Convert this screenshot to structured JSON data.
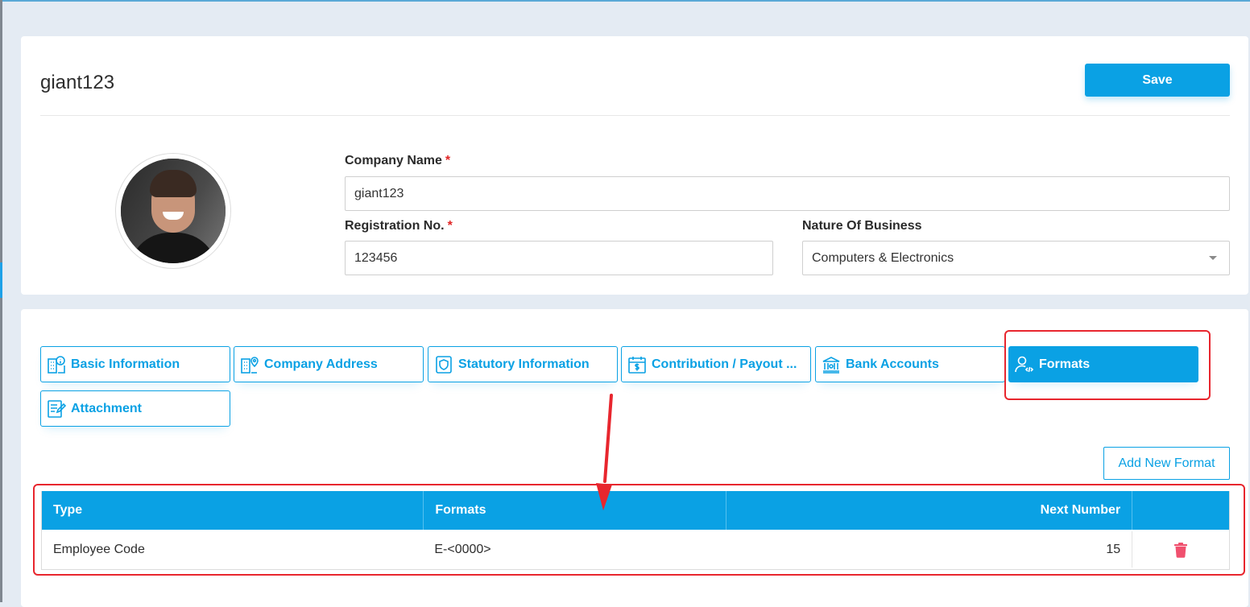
{
  "header": {
    "title": "giant123",
    "save_label": "Save"
  },
  "form": {
    "company_name": {
      "label": "Company Name",
      "required": "*",
      "value": "giant123"
    },
    "registration_no": {
      "label": "Registration No.",
      "required": "*",
      "value": "123456"
    },
    "nature_of_business": {
      "label": "Nature Of Business",
      "value": "Computers & Electronics"
    }
  },
  "tabs": [
    {
      "label": "Basic Information",
      "icon": "building-info-icon",
      "active": false
    },
    {
      "label": "Company Address",
      "icon": "building-pin-icon",
      "active": false
    },
    {
      "label": "Statutory Information",
      "icon": "shield-document-icon",
      "active": false
    },
    {
      "label": "Contribution / Payout ...",
      "icon": "calendar-dollar-icon",
      "active": false
    },
    {
      "label": "Bank Accounts",
      "icon": "bank-icon",
      "active": false
    },
    {
      "label": "Formats",
      "icon": "user-code-icon",
      "active": true
    },
    {
      "label": "Attachment",
      "icon": "document-edit-icon",
      "active": false
    }
  ],
  "formats": {
    "add_label": "Add New Format",
    "columns": [
      "Type",
      "Formats",
      "Next Number",
      ""
    ],
    "rows": [
      {
        "type": "Employee Code",
        "format": "E-<0000>",
        "next_number": "15"
      }
    ]
  },
  "colors": {
    "accent": "#0aa1e4",
    "highlight": "#e8262e",
    "delete": "#f0506e"
  }
}
